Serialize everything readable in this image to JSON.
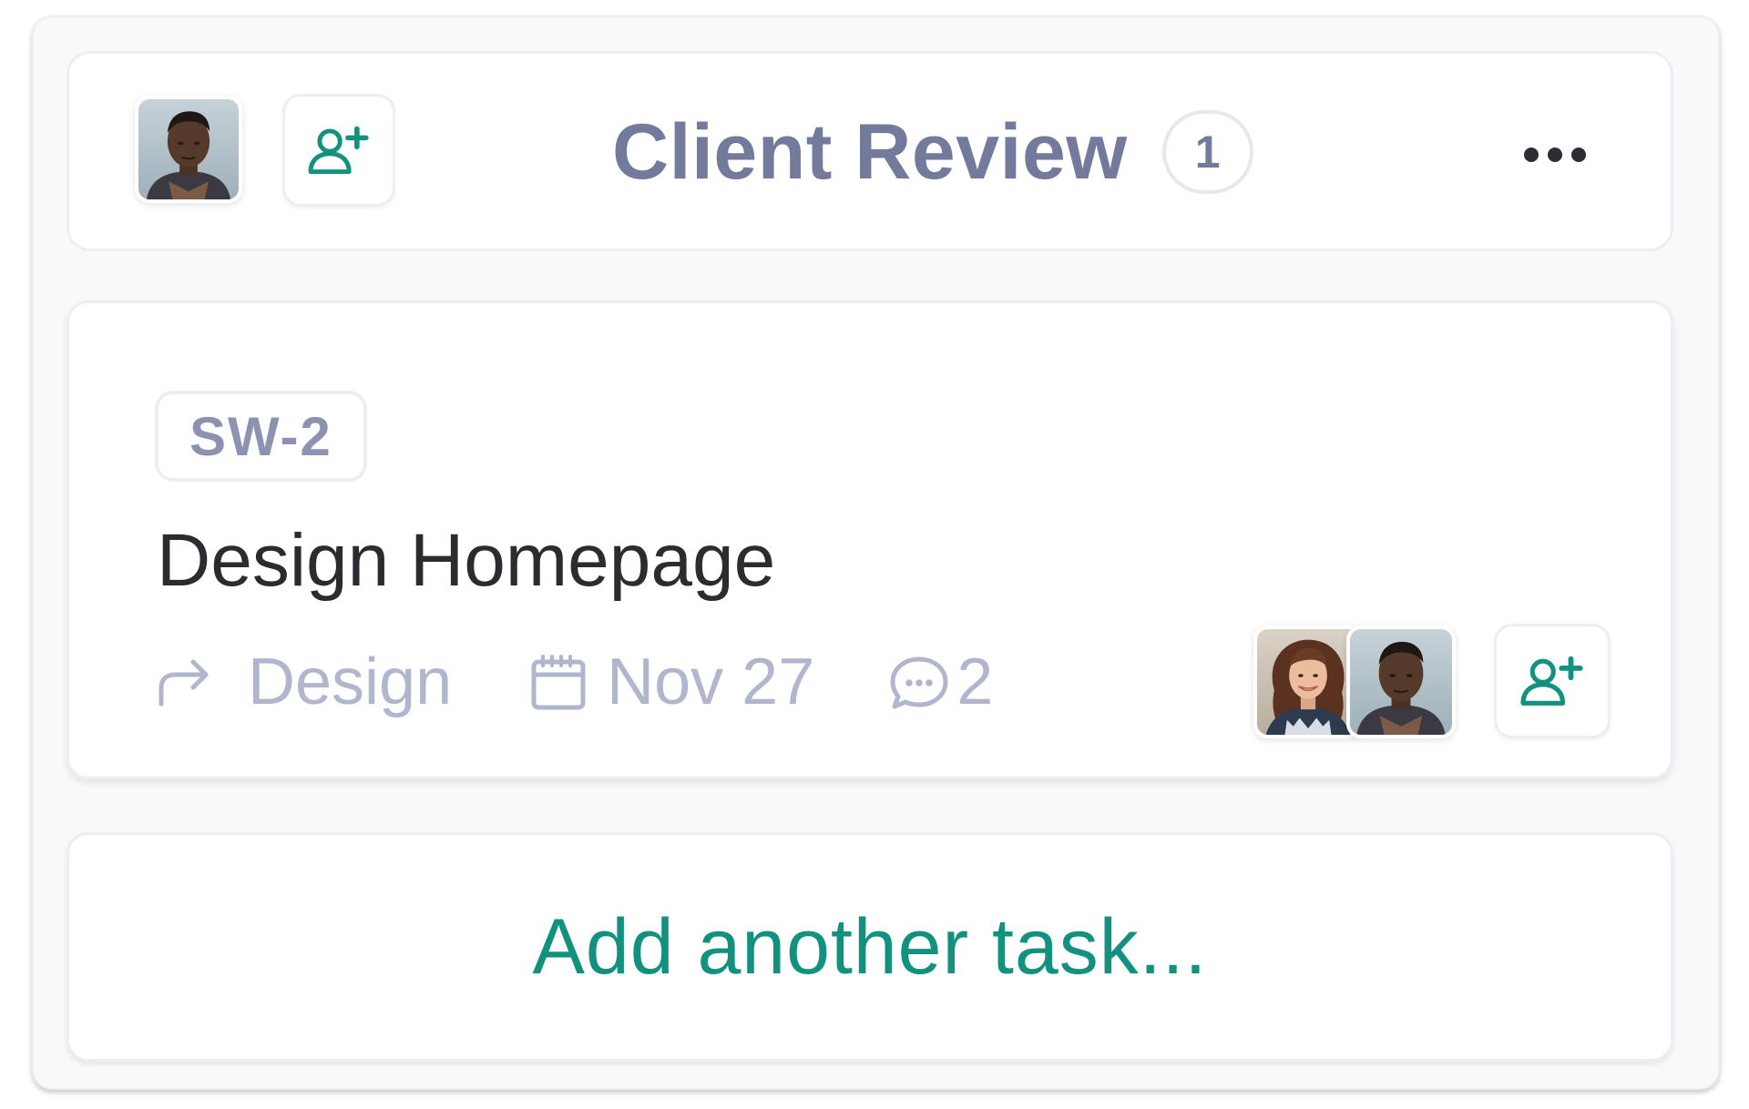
{
  "colors": {
    "accent": "#12917f",
    "header_text": "#747a9b",
    "meta_text": "#b2b6cd",
    "title_text": "#2c2c30"
  },
  "column": {
    "title": "Client Review",
    "task_count": "1",
    "owner_avatar": "person-avatar-man",
    "add_user_icon": "add-user-icon",
    "more_icon": "more-horizontal-icon"
  },
  "task": {
    "id": "SW-2",
    "title": "Design Homepage",
    "category": "Design",
    "category_icon": "share-arrow-icon",
    "due_date": "Nov 27",
    "due_icon": "calendar-icon",
    "comment_count": "2",
    "comment_icon": "comment-icon",
    "assignees": [
      "person-avatar-woman",
      "person-avatar-man"
    ],
    "add_user_icon": "add-user-icon"
  },
  "add_task": {
    "label": "Add another task..."
  }
}
